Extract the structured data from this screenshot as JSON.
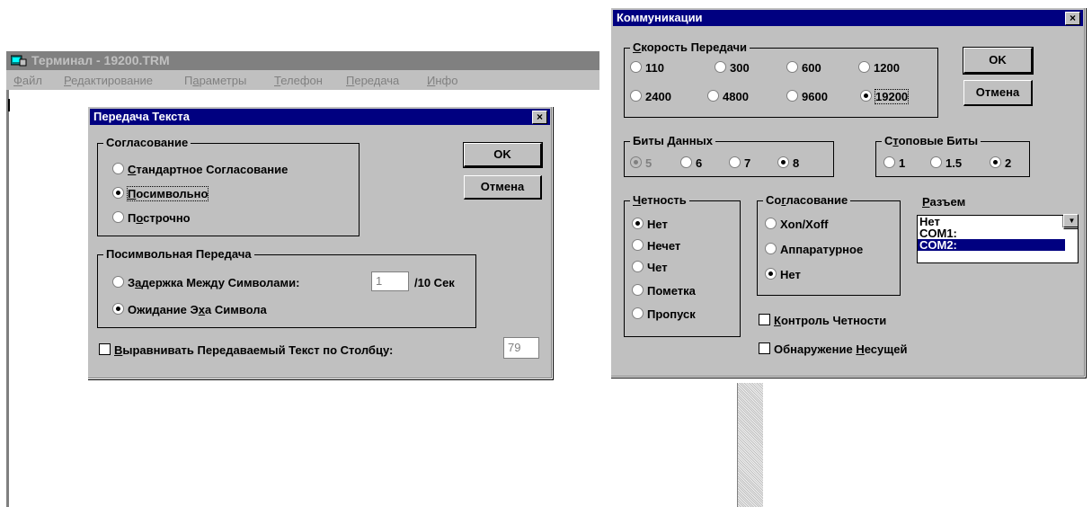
{
  "terminal": {
    "title": "Терминал - 19200.TRM",
    "menu": [
      {
        "u": "Ф",
        "rest": "айл"
      },
      {
        "u": "Р",
        "rest": "едактирование"
      },
      {
        "pre": "П",
        "u": "а",
        "rest": "раметры"
      },
      {
        "u": "Т",
        "rest": "елефон"
      },
      {
        "u": "П",
        "rest": "ередача"
      },
      {
        "u": "И",
        "rest": "нфо"
      }
    ]
  },
  "text_dialog": {
    "title": "Передача Текста",
    "close": "×",
    "group1": "Согласование",
    "opt_standard_u": "С",
    "opt_standard": "тандартное Согласование",
    "opt_bychar_u": "П",
    "opt_bychar": "осимвольно",
    "opt_byline_pre": "П",
    "opt_byline_u": "о",
    "opt_byline": "строчно",
    "group2": "Посимвольная Передача",
    "delay_pre": "З",
    "delay_u": "а",
    "delay": "держка Между Символами:",
    "delay_value": "1",
    "delay_unit": "/10 Сек",
    "echo_pre": "Ожидание Э",
    "echo_u": "х",
    "echo": "а Символа",
    "wrap_u": "В",
    "wrap": "ыравнивать Передаваемый Текст по Столбцу:",
    "wrap_value": "79",
    "ok": "OK",
    "cancel": "Отмена"
  },
  "comm_dialog": {
    "title": "Коммуникации",
    "close": "×",
    "speed_u": "С",
    "speed": "корость Передачи",
    "speeds": [
      "110",
      "300",
      "600",
      "1200",
      "2400",
      "4800",
      "9600",
      "19200"
    ],
    "speed_selected": "19200",
    "databits_pre": "Биты ",
    "databits_u": "Д",
    "databits": "анных",
    "databits_opts": [
      "5",
      "6",
      "7",
      "8"
    ],
    "databits_selected": "8",
    "stopbits_pre": "С",
    "stopbits_u": "т",
    "stopbits": "оповые Биты",
    "stopbits_opts": [
      "1",
      "1.5",
      "2"
    ],
    "stopbits_selected": "2",
    "parity_u": "Ч",
    "parity": "етность",
    "parity_opts": [
      "Нет",
      "Нечет",
      "Чет",
      "Пометка",
      "Пропуск"
    ],
    "parity_selected": "Нет",
    "flow_pre": "Со",
    "flow_u": "г",
    "flow": "ласование",
    "flow_opts": [
      "Xon/Xoff",
      "Аппаратурное",
      "Нет"
    ],
    "flow_selected": "Нет",
    "port_u": "Р",
    "port": "азъем",
    "port_opts": [
      "Нет",
      "COM1:",
      "COM2:"
    ],
    "port_selected": "COM2:",
    "parity_check_u": "К",
    "parity_check": "онтроль Четности",
    "carrier_pre": "Обнаружение ",
    "carrier_u": "Н",
    "carrier": "есущей",
    "ok": "OK",
    "cancel": "Отмена"
  }
}
